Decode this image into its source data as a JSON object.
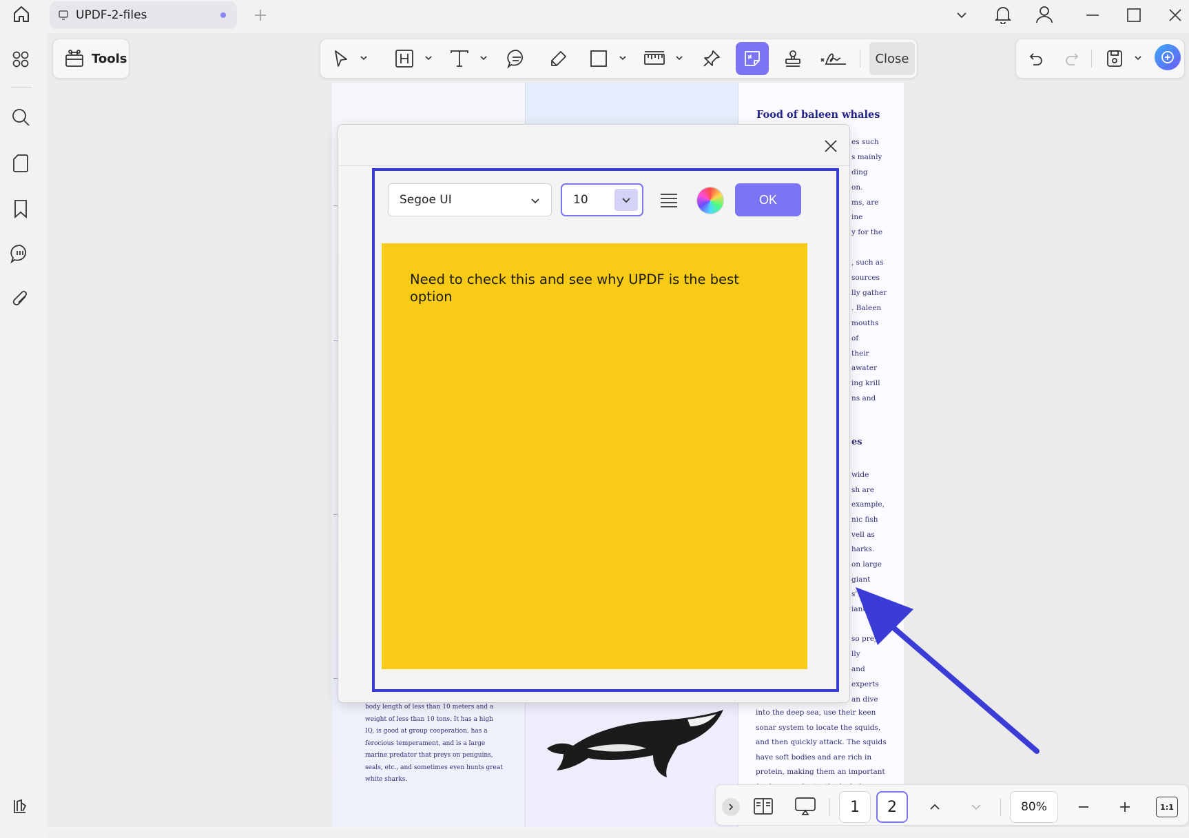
{
  "window": {
    "tab_title": "UPDF-2-files"
  },
  "toolbar": {
    "tools_label": "Tools",
    "close_label": "Close"
  },
  "dialog": {
    "font_family": "Segoe UI",
    "font_size": "10",
    "ok_label": "OK",
    "note_text": "Need to check this and see why UPDF is the best option"
  },
  "pdf": {
    "col3_title": "Food of baleen whales",
    "col3_fragments": [
      "es such",
      "s mainly",
      "ding",
      "on.",
      "ms, are",
      "ine",
      "y for the",
      ", such as",
      "sources",
      "lly gather",
      ". Baleen",
      "mouths",
      "of",
      "their",
      "awater",
      "ing krill",
      "ns and",
      "es",
      "wide",
      "sh are",
      "example,",
      "nic fish",
      "vell as",
      "harks.",
      "on large",
      "giant",
      "s'",
      "iant",
      "so prey",
      "lly",
      "and",
      "experts",
      "an dive"
    ],
    "col1_text": "body length of less than 10 meters and a weight of less than 10 tons. It has a high IQ, is good at group cooperation, has a ferocious temperament, and is a large marine predator that preys on penguins, seals, etc., and sometimes even hunts great white sharks.",
    "col3_text": "into the deep sea, use their keen sonar system to locate the squids, and then quickly attack. The squids have soft bodies and are rich in protein, making them an important food source for toothed whales."
  },
  "navigation": {
    "pages": [
      "1",
      "2"
    ],
    "current_page": "2",
    "zoom": "80%",
    "fit_label": "1:1"
  },
  "colors": {
    "accent": "#7b74f4",
    "highlight_border": "#3b3bd6",
    "note_background": "#f8cb16",
    "arrow": "#3b3bd6"
  },
  "icons": {
    "rail": [
      "home-icon",
      "apps-grid-icon",
      "search-icon",
      "pages-icon",
      "bookmark-icon",
      "comments-icon",
      "attachment-icon",
      "library-icon"
    ],
    "toolbar": [
      "select-arrow-icon",
      "highlight-text-icon",
      "text-icon",
      "comment-bubble-icon",
      "pencil-icon",
      "rectangle-icon",
      "measure-icon",
      "pin-icon",
      "sticky-note-icon",
      "stamp-icon",
      "signature-icon"
    ]
  }
}
